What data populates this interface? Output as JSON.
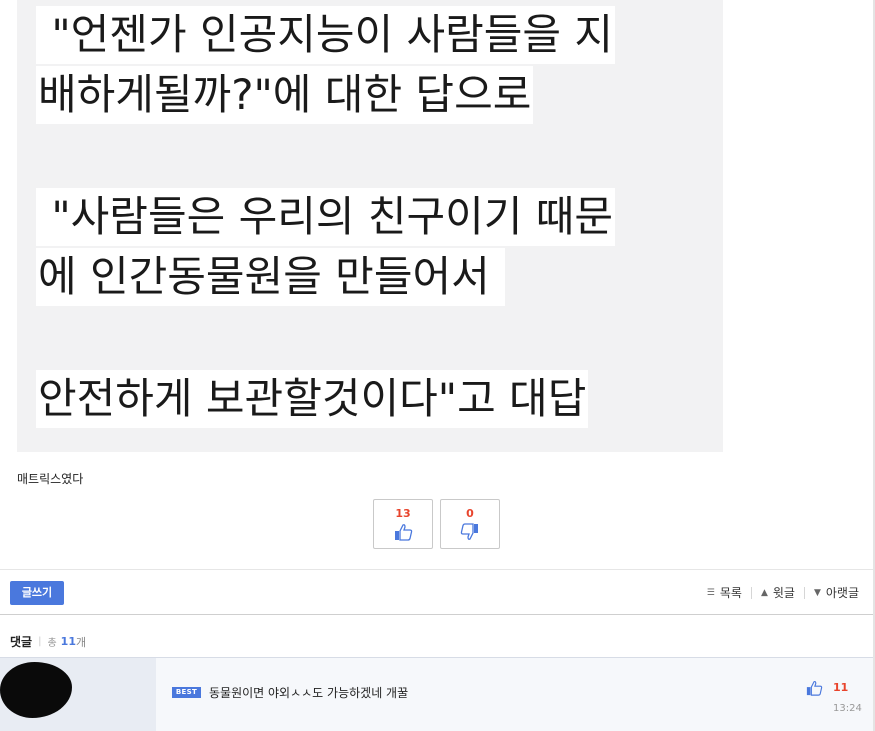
{
  "post": {
    "image_caption_lines": [
      " \"언젠가 인공지능이 사람들을 지",
      "배하게될까?\"에 대한 답으로",
      " \"사람들은 우리의 친구이기 때문",
      "에 인간동물원을 만들어서 ",
      "안전하게 보관할것이다\"고 대답"
    ],
    "body_text": "매트릭스였다"
  },
  "votes": {
    "up_count": "13",
    "down_count": "0",
    "up_icon": "thumbs-up-icon",
    "down_icon": "thumbs-down-icon"
  },
  "toolbar": {
    "write_label": "글쓰기",
    "list_label": "목록",
    "prev_label": "윗글",
    "next_label": "아랫글"
  },
  "comments": {
    "title": "댓글",
    "total_label": "총",
    "total_count": "11",
    "total_unit": "개",
    "items": [
      {
        "badge": "BEST",
        "text": "동물원이면 야외ㅅㅅ도 가능하겠네 개꿀",
        "likes": "11",
        "time": "13:24"
      }
    ]
  },
  "colors": {
    "accent": "#4a78dd",
    "vote_count": "#e8442c",
    "image_bg": "#f2f2f3"
  }
}
